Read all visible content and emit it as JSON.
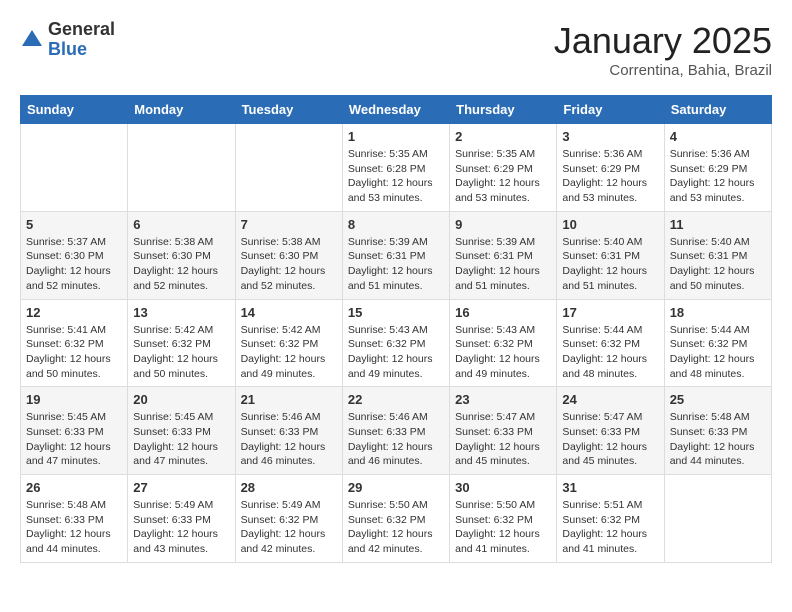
{
  "header": {
    "logo_general": "General",
    "logo_blue": "Blue",
    "month_title": "January 2025",
    "subtitle": "Correntina, Bahia, Brazil"
  },
  "weekdays": [
    "Sunday",
    "Monday",
    "Tuesday",
    "Wednesday",
    "Thursday",
    "Friday",
    "Saturday"
  ],
  "weeks": [
    [
      {
        "day": "",
        "info": ""
      },
      {
        "day": "",
        "info": ""
      },
      {
        "day": "",
        "info": ""
      },
      {
        "day": "1",
        "info": "Sunrise: 5:35 AM\nSunset: 6:28 PM\nDaylight: 12 hours\nand 53 minutes."
      },
      {
        "day": "2",
        "info": "Sunrise: 5:35 AM\nSunset: 6:29 PM\nDaylight: 12 hours\nand 53 minutes."
      },
      {
        "day": "3",
        "info": "Sunrise: 5:36 AM\nSunset: 6:29 PM\nDaylight: 12 hours\nand 53 minutes."
      },
      {
        "day": "4",
        "info": "Sunrise: 5:36 AM\nSunset: 6:29 PM\nDaylight: 12 hours\nand 53 minutes."
      }
    ],
    [
      {
        "day": "5",
        "info": "Sunrise: 5:37 AM\nSunset: 6:30 PM\nDaylight: 12 hours\nand 52 minutes."
      },
      {
        "day": "6",
        "info": "Sunrise: 5:38 AM\nSunset: 6:30 PM\nDaylight: 12 hours\nand 52 minutes."
      },
      {
        "day": "7",
        "info": "Sunrise: 5:38 AM\nSunset: 6:30 PM\nDaylight: 12 hours\nand 52 minutes."
      },
      {
        "day": "8",
        "info": "Sunrise: 5:39 AM\nSunset: 6:31 PM\nDaylight: 12 hours\nand 51 minutes."
      },
      {
        "day": "9",
        "info": "Sunrise: 5:39 AM\nSunset: 6:31 PM\nDaylight: 12 hours\nand 51 minutes."
      },
      {
        "day": "10",
        "info": "Sunrise: 5:40 AM\nSunset: 6:31 PM\nDaylight: 12 hours\nand 51 minutes."
      },
      {
        "day": "11",
        "info": "Sunrise: 5:40 AM\nSunset: 6:31 PM\nDaylight: 12 hours\nand 50 minutes."
      }
    ],
    [
      {
        "day": "12",
        "info": "Sunrise: 5:41 AM\nSunset: 6:32 PM\nDaylight: 12 hours\nand 50 minutes."
      },
      {
        "day": "13",
        "info": "Sunrise: 5:42 AM\nSunset: 6:32 PM\nDaylight: 12 hours\nand 50 minutes."
      },
      {
        "day": "14",
        "info": "Sunrise: 5:42 AM\nSunset: 6:32 PM\nDaylight: 12 hours\nand 49 minutes."
      },
      {
        "day": "15",
        "info": "Sunrise: 5:43 AM\nSunset: 6:32 PM\nDaylight: 12 hours\nand 49 minutes."
      },
      {
        "day": "16",
        "info": "Sunrise: 5:43 AM\nSunset: 6:32 PM\nDaylight: 12 hours\nand 49 minutes."
      },
      {
        "day": "17",
        "info": "Sunrise: 5:44 AM\nSunset: 6:32 PM\nDaylight: 12 hours\nand 48 minutes."
      },
      {
        "day": "18",
        "info": "Sunrise: 5:44 AM\nSunset: 6:32 PM\nDaylight: 12 hours\nand 48 minutes."
      }
    ],
    [
      {
        "day": "19",
        "info": "Sunrise: 5:45 AM\nSunset: 6:33 PM\nDaylight: 12 hours\nand 47 minutes."
      },
      {
        "day": "20",
        "info": "Sunrise: 5:45 AM\nSunset: 6:33 PM\nDaylight: 12 hours\nand 47 minutes."
      },
      {
        "day": "21",
        "info": "Sunrise: 5:46 AM\nSunset: 6:33 PM\nDaylight: 12 hours\nand 46 minutes."
      },
      {
        "day": "22",
        "info": "Sunrise: 5:46 AM\nSunset: 6:33 PM\nDaylight: 12 hours\nand 46 minutes."
      },
      {
        "day": "23",
        "info": "Sunrise: 5:47 AM\nSunset: 6:33 PM\nDaylight: 12 hours\nand 45 minutes."
      },
      {
        "day": "24",
        "info": "Sunrise: 5:47 AM\nSunset: 6:33 PM\nDaylight: 12 hours\nand 45 minutes."
      },
      {
        "day": "25",
        "info": "Sunrise: 5:48 AM\nSunset: 6:33 PM\nDaylight: 12 hours\nand 44 minutes."
      }
    ],
    [
      {
        "day": "26",
        "info": "Sunrise: 5:48 AM\nSunset: 6:33 PM\nDaylight: 12 hours\nand 44 minutes."
      },
      {
        "day": "27",
        "info": "Sunrise: 5:49 AM\nSunset: 6:33 PM\nDaylight: 12 hours\nand 43 minutes."
      },
      {
        "day": "28",
        "info": "Sunrise: 5:49 AM\nSunset: 6:32 PM\nDaylight: 12 hours\nand 42 minutes."
      },
      {
        "day": "29",
        "info": "Sunrise: 5:50 AM\nSunset: 6:32 PM\nDaylight: 12 hours\nand 42 minutes."
      },
      {
        "day": "30",
        "info": "Sunrise: 5:50 AM\nSunset: 6:32 PM\nDaylight: 12 hours\nand 41 minutes."
      },
      {
        "day": "31",
        "info": "Sunrise: 5:51 AM\nSunset: 6:32 PM\nDaylight: 12 hours\nand 41 minutes."
      },
      {
        "day": "",
        "info": ""
      }
    ]
  ]
}
